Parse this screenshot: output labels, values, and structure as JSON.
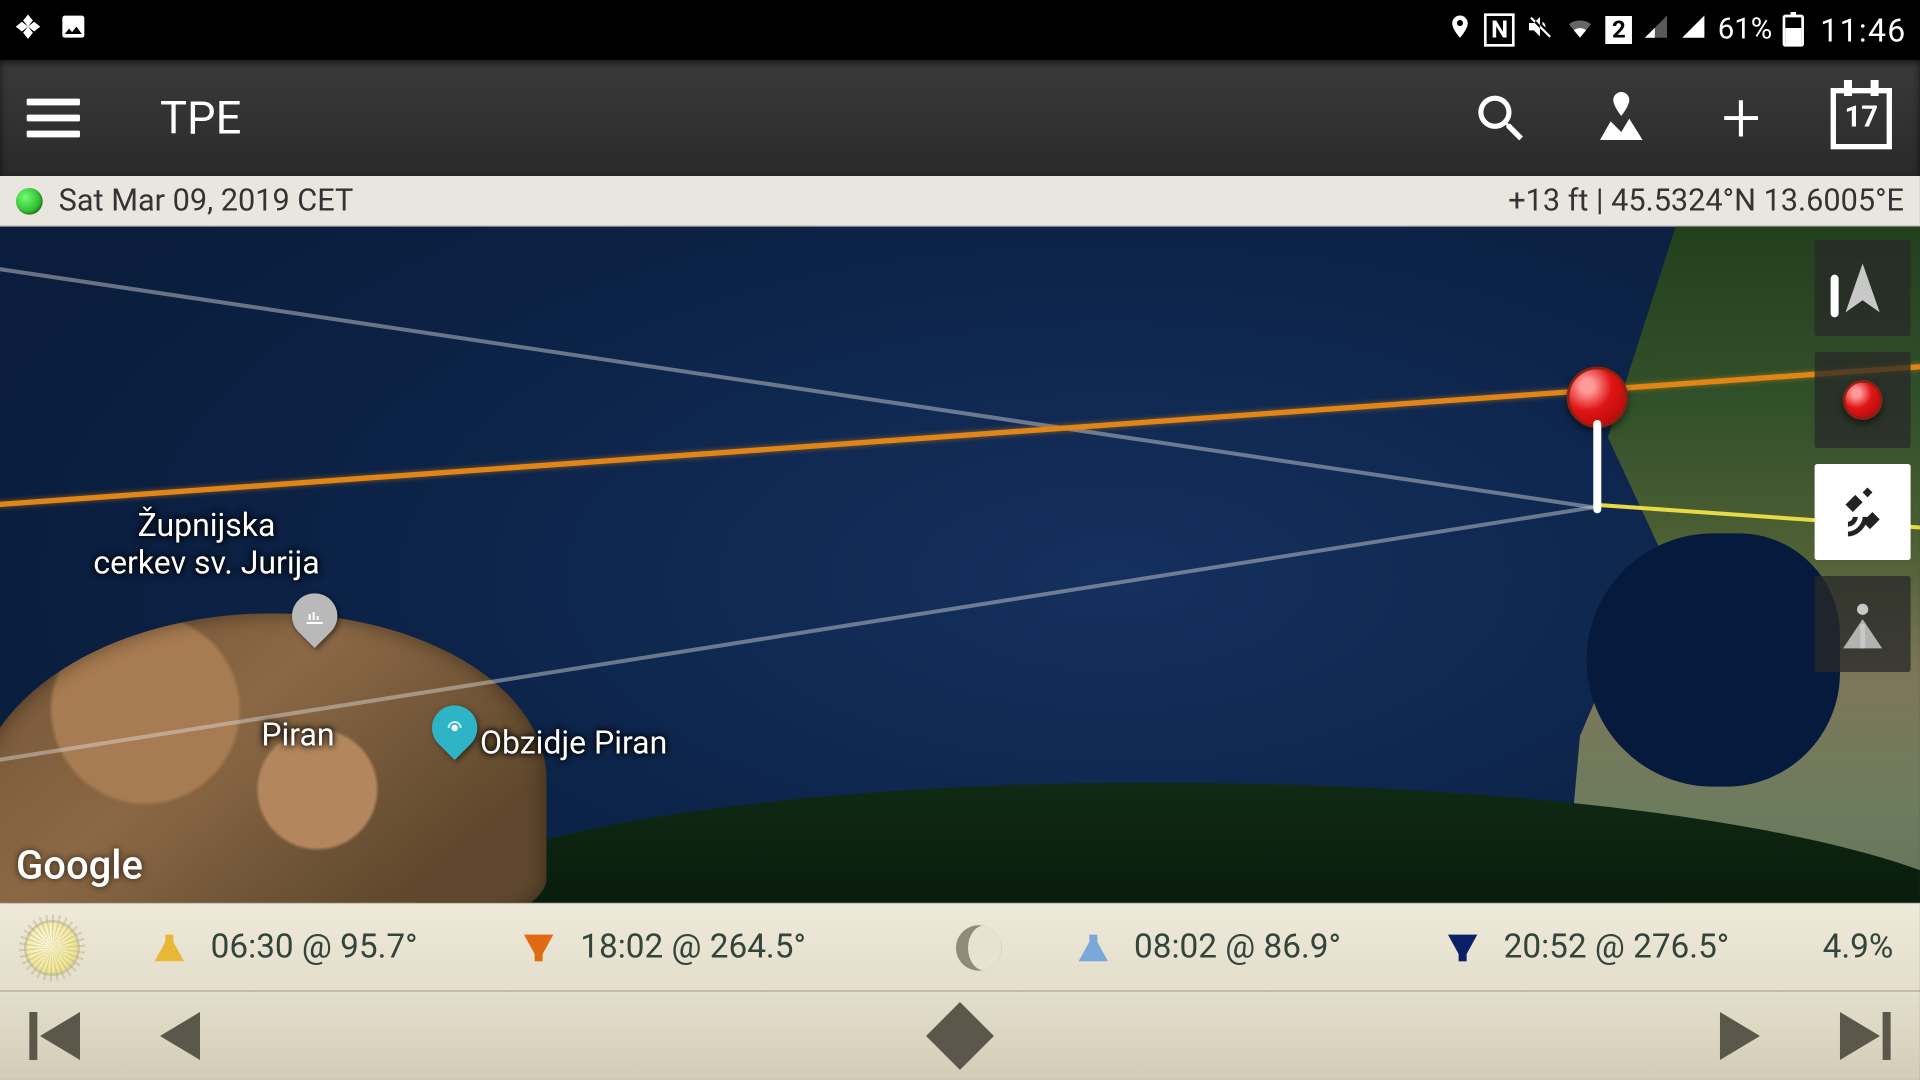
{
  "status_bar": {
    "battery": "61%",
    "time": "11:46",
    "sim": "2"
  },
  "app_bar": {
    "title": "TPE",
    "calendar_day": "17"
  },
  "info_strip": {
    "date": "Sat Mar 09, 2019 CET",
    "coords": "+13 ft | 45.5324°N 13.6005°E"
  },
  "map": {
    "attribution": "Google",
    "labels": {
      "church": "Župnijska\ncerkev sv. Jurija",
      "piran": "Piran",
      "wall": "Obzidje Piran"
    },
    "controls": [
      "compass",
      "primary-pin",
      "satellite-layer",
      "streetview"
    ]
  },
  "ephemeris": {
    "sunrise": "06:30 @ 95.7°",
    "sunset": "18:02 @ 264.5°",
    "moonrise": "08:02 @ 86.9°",
    "moonset": "20:52 @ 276.5°",
    "moon_illumination": "4.9%"
  }
}
